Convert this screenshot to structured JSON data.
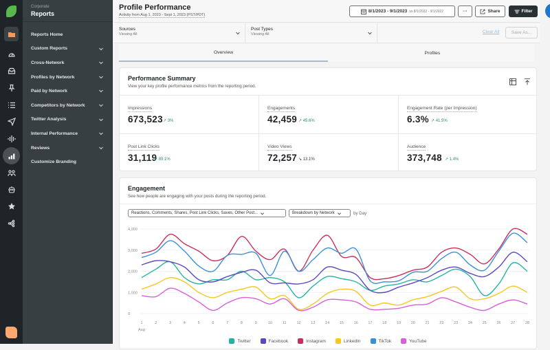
{
  "left_rail": {
    "icons": [
      "logo-icon",
      "folder-icon",
      "dashboard-icon",
      "inbox-icon",
      "pin-icon",
      "list-icon",
      "send-icon",
      "listening-icon",
      "reports-icon",
      "people-icon",
      "bot-icon",
      "star-review-icon",
      "network-icon",
      "app-launcher-icon"
    ]
  },
  "subnav": {
    "group": "Corporate",
    "title": "Reports",
    "items": [
      {
        "label": "Reports Home",
        "expandable": false
      },
      {
        "label": "Custom Reports",
        "expandable": true
      },
      {
        "label": "Cross-Network",
        "expandable": true
      },
      {
        "label": "Profiles by Network",
        "expandable": true
      },
      {
        "label": "Paid by Network",
        "expandable": true
      },
      {
        "label": "Competitors by Network",
        "expandable": true
      },
      {
        "label": "Twitter Analysis",
        "expandable": true
      },
      {
        "label": "Internal Performance",
        "expandable": true
      },
      {
        "label": "Reviews",
        "expandable": true
      },
      {
        "label": "Customize Branding",
        "expandable": false
      }
    ]
  },
  "header": {
    "title": "Profile Performance",
    "subtitle": "Activity from Aug 1, 2023 - Sept 1, 2023 (PST/PDT)",
    "date_range": "8/1/2023 - 9/1/2023",
    "compare_range": "vs 8/1/2022 - 9/1/2022",
    "more_label": "···",
    "share_label": "Share",
    "filter_label": "Filter"
  },
  "filters": {
    "sources": {
      "label": "Sources",
      "value": "Viewing All"
    },
    "post_types": {
      "label": "Post Types",
      "value": "Viewing All"
    },
    "clear_all": "Clear All",
    "save_as": "Save As..."
  },
  "tabs": [
    {
      "label": "Overview",
      "active": true
    },
    {
      "label": "Profiles",
      "active": false
    }
  ],
  "summary": {
    "title": "Performance Summary",
    "description": "View your key profile performance metrics from the reporting period.",
    "metrics": [
      {
        "label": "Impressions",
        "value": "673,523",
        "delta": "3%",
        "direction": "up"
      },
      {
        "label": "Engagements",
        "value": "42,459",
        "delta": "45.6%",
        "direction": "up"
      },
      {
        "label": "Engagement Rate (per Impression)",
        "value": "6.3%",
        "delta": "41.5%",
        "direction": "up"
      },
      {
        "label": "Post Link Clicks",
        "value": "31,119",
        "delta": "89.1%",
        "direction": "up"
      },
      {
        "label": "Video Views",
        "value": "72,257",
        "delta": "13.1%",
        "direction": "down"
      },
      {
        "label": "Audience",
        "value": "373,748",
        "delta": "1.4%",
        "direction": "up"
      }
    ]
  },
  "engagement": {
    "title": "Engagement",
    "description": "See how people are engaging with your posts during the reporting period.",
    "metric_select": "Reactions, Comments, Shares, Post Link Clicks, Saves, Other Post...",
    "breakdown_select": "Breakdown by Network",
    "by_label": "by Day"
  },
  "chart_data": {
    "type": "line",
    "title": "Engagement",
    "xlabel": "Aug",
    "ylabel": "",
    "x": [
      1,
      2,
      3,
      4,
      5,
      6,
      7,
      8,
      9,
      10,
      11,
      12,
      13,
      14,
      15,
      16,
      17,
      18,
      19,
      20,
      21,
      22,
      23,
      24,
      25,
      26,
      27,
      28
    ],
    "x_sublabel": "Aug",
    "ylim": [
      0,
      4000
    ],
    "yticks": [
      "0",
      "1,000",
      "2,000",
      "3,000",
      "4,000"
    ],
    "ytick_values": [
      0,
      1000,
      2000,
      3000,
      4000
    ],
    "grid": true,
    "legend_position": "bottom-center",
    "series": [
      {
        "name": "Twitter",
        "color": "#22b3a3",
        "values": [
          1700,
          2100,
          2450,
          1700,
          1400,
          1600,
          1600,
          2000,
          1600,
          1700,
          1500,
          750,
          1300,
          1750,
          1650,
          1500,
          1100,
          1300,
          1400,
          1600,
          1500,
          1800,
          2100,
          1750,
          850,
          1400,
          2400,
          2000
        ]
      },
      {
        "name": "Facebook",
        "color": "#5c47c2",
        "values": [
          2300,
          2500,
          2450,
          2200,
          1600,
          1500,
          1750,
          1950,
          2050,
          1450,
          1450,
          1400,
          1600,
          2200,
          2050,
          1850,
          1100,
          1000,
          1250,
          1450,
          1700,
          2050,
          2200,
          1900,
          1750,
          2200,
          2900,
          2450
        ]
      },
      {
        "name": "Instagram",
        "color": "#cc2f5c",
        "values": [
          2850,
          3050,
          3750,
          3300,
          2950,
          2500,
          2750,
          3650,
          2950,
          2550,
          3050,
          2000,
          3000,
          3700,
          2700,
          2650,
          1700,
          1650,
          1800,
          2050,
          2200,
          2900,
          3100,
          2800,
          2350,
          3050,
          4000,
          3750
        ]
      },
      {
        "name": "LinkedIn",
        "color": "#f7c623",
        "values": [
          1150,
          1400,
          1700,
          1500,
          1000,
          750,
          1000,
          1150,
          1250,
          700,
          850,
          200,
          450,
          950,
          1150,
          1050,
          400,
          500,
          400,
          650,
          800,
          1050,
          1250,
          700,
          700,
          950,
          1300,
          1000
        ]
      },
      {
        "name": "TikTok",
        "color": "#3b8fd8",
        "values": [
          2650,
          2900,
          3450,
          2950,
          2250,
          2000,
          2750,
          2800,
          2850,
          1800,
          2950,
          2000,
          2550,
          3100,
          2850,
          3050,
          1550,
          1500,
          1550,
          1950,
          2000,
          2600,
          2900,
          2300,
          2050,
          2950,
          3800,
          3350
        ]
      },
      {
        "name": "YouTube",
        "color": "#d85fd9",
        "values": [
          850,
          800,
          1200,
          950,
          550,
          150,
          500,
          750,
          700,
          450,
          700,
          150,
          300,
          650,
          650,
          550,
          200,
          200,
          250,
          400,
          450,
          750,
          550,
          300,
          150,
          450,
          650,
          450
        ]
      }
    ]
  }
}
